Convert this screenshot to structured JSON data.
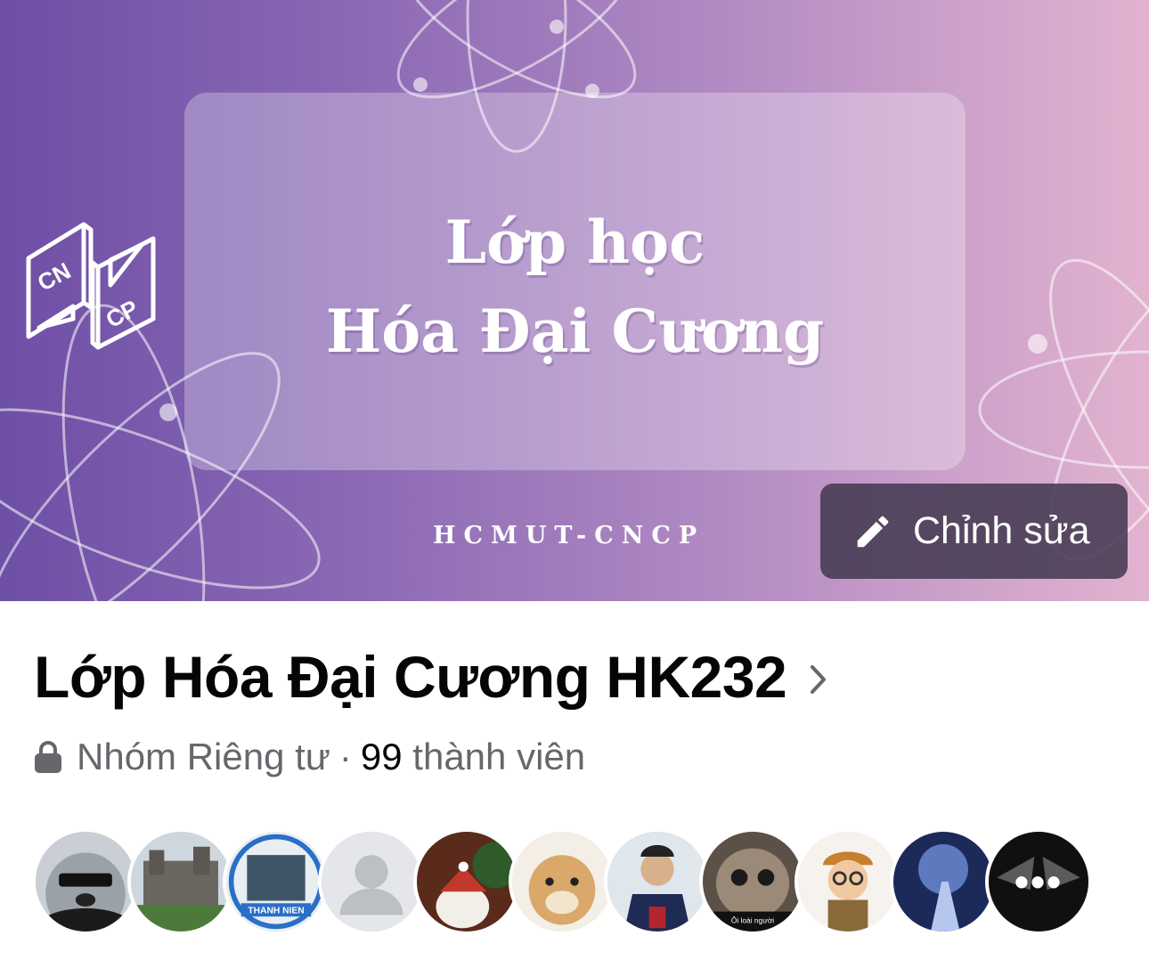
{
  "cover": {
    "title_line1": "Lớp học",
    "title_line2": "Hóa Đại Cương",
    "tagline": "HCMUT-CNCP",
    "logo_top": "CN",
    "logo_bottom": "CP",
    "edit_label": "Chỉnh sửa",
    "edit_icon": "pencil-icon"
  },
  "group": {
    "name": "Lớp Hóa Đại Cương HK232",
    "privacy": "Nhóm Riêng tư",
    "separator": "·",
    "member_count": "99",
    "member_label": "thành viên"
  },
  "avatars": {
    "count_shown": 11,
    "more_label": "•••",
    "badge_text": "THANH NIEN",
    "caption_text": "Ôi loài người"
  },
  "colors": {
    "cover_left": "#6d4fa6",
    "cover_right": "#e2b3cf",
    "text_primary": "#050505",
    "text_secondary": "#65676b"
  }
}
